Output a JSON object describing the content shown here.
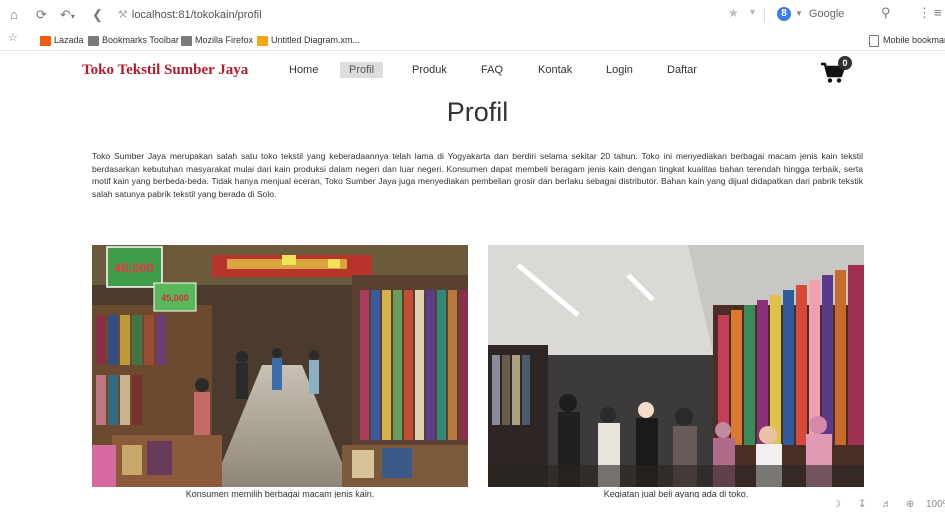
{
  "browser": {
    "url": "localhost:81/tokokain/profil",
    "search_engine": "Google",
    "search_badge": "8",
    "bookmarks": [
      "Lazada",
      "Bookmarks Toolbar",
      "Mozilla Firefox",
      "Untitled Diagram.xm..."
    ],
    "mobile_bookmarks": "Mobile bookmar",
    "zoom": "100%"
  },
  "site": {
    "brand": "Toko Tekstil Sumber Jaya",
    "nav": [
      "Home",
      "Profil",
      "Produk",
      "FAQ",
      "Kontak",
      "Login",
      "Daftar"
    ],
    "active_nav": "Profil",
    "cart_count": "0"
  },
  "page": {
    "title": "Profil",
    "intro": "Toko Sumber Jaya merupakan salah satu toko tekstil yang keberadaannya telah lama di Yogyakarta dan berdiri selama sekitar 20 tahun. Toko ini menyediakan berbagai macam jenis kain tekstil berdasarkan kebutuhan masyarakat mulai dari kain produksi dalam negeri dan luar negeri. Konsumen dapat membeli beragam jenis kain dengan tingkat kualitas bahan terendah hingga terbaik, serta motif kain yang berbeda-beda. Tidak hanya menjual eceran, Toko Sumber Jaya juga menyediakan pembelian grosir dan berlaku sebagai distributor. Bahan kain yang dijual didapatkan dari pabrik tekstik salah satunya pabrik tekstil yang berada di Solo.",
    "photos": [
      {
        "caption": "Konsumen memilih berbagai macam jenis kain.",
        "sign1": "46,000",
        "sign2": "45,000"
      },
      {
        "caption": "Kegiatan jual beli ayang ada di toko."
      }
    ]
  },
  "colors": {
    "brand": "#b41b2d",
    "nav_active_bg": "#dddddd"
  }
}
